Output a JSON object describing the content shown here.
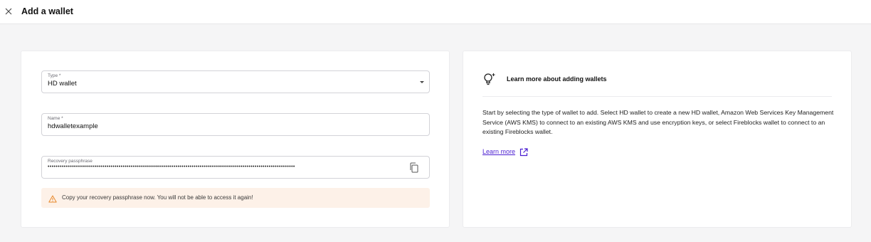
{
  "header": {
    "title": "Add a wallet",
    "close_icon": "close-icon"
  },
  "form": {
    "type": {
      "label": "Type *",
      "value": "HD wallet"
    },
    "name": {
      "label": "Name *",
      "value": "hdwalletexample"
    },
    "recovery": {
      "label": "Recovery passphrase",
      "value": "••••••••••••••••••••••••••••••••••••••••••••••••••••••••••••••••••••••••••••••••••••••••••••••••••••••••••••••••••••••••••",
      "copy_icon": "copy-icon"
    },
    "warning": {
      "icon": "warning-icon",
      "text": "Copy your recovery passphrase now. You will not be able to access it again!"
    }
  },
  "info": {
    "icon": "lightbulb-icon",
    "title": "Learn more about adding wallets",
    "body": "Start by selecting the type of wallet to add. Select HD wallet to create a new HD wallet, Amazon Web Services Key Management Service (AWS KMS) to connect to an existing AWS KMS and use encryption keys, or select Fireblocks wallet to connect to an existing Fireblocks wallet.",
    "link_label": "Learn more",
    "link_icon": "external-link-icon"
  },
  "colors": {
    "link": "#4b1fd1",
    "warning_bg": "#fdf1e8",
    "warning_accent": "#e8892b",
    "background": "#f5f5f6"
  }
}
